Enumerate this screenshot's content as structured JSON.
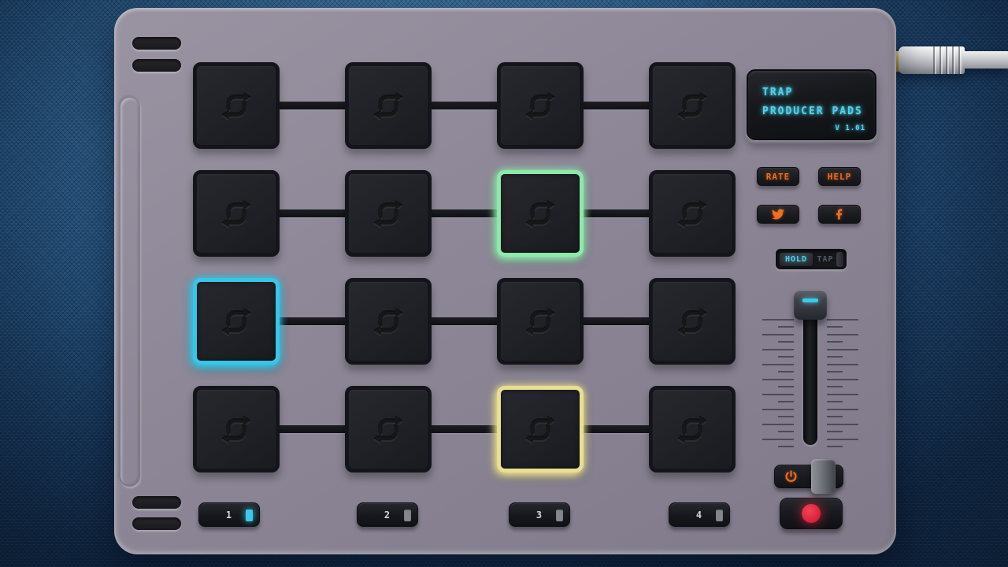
{
  "colors": {
    "lcd-text": "#4fd2ea",
    "accent-orange": "#ee6f1e",
    "record-red": "#d92136",
    "led-cyan": "#3cc9e8",
    "pad-green": "#8fe7ab",
    "pad-cyan": "#35c7e8",
    "pad-yellow": "#e9df92"
  },
  "lcd": {
    "line1": "TRAP",
    "line2": "PRODUCER PADS",
    "version": "V 1.01"
  },
  "buttons": {
    "rate": "RATE",
    "help": "HELP"
  },
  "social": {
    "icons": [
      "twitter",
      "facebook"
    ]
  },
  "mode_toggle": {
    "options": [
      "HOLD",
      "TAP"
    ],
    "active": "HOLD"
  },
  "fader": {
    "position": "top",
    "value_percent": 100
  },
  "power": {
    "icon": "power"
  },
  "record": {
    "icon": "record-dot"
  },
  "banks": [
    {
      "label": "1",
      "led": "on"
    },
    {
      "label": "2",
      "led": "off"
    },
    {
      "label": "3",
      "led": "off"
    },
    {
      "label": "4",
      "led": "off"
    }
  ],
  "pads": {
    "rows": 4,
    "cols": 4,
    "glyph": "loop-logo",
    "active": [
      {
        "row": 2,
        "col": 3,
        "accent": "pad-green"
      },
      {
        "row": 3,
        "col": 1,
        "accent": "pad-cyan"
      },
      {
        "row": 4,
        "col": 3,
        "accent": "pad-yellow"
      }
    ]
  }
}
